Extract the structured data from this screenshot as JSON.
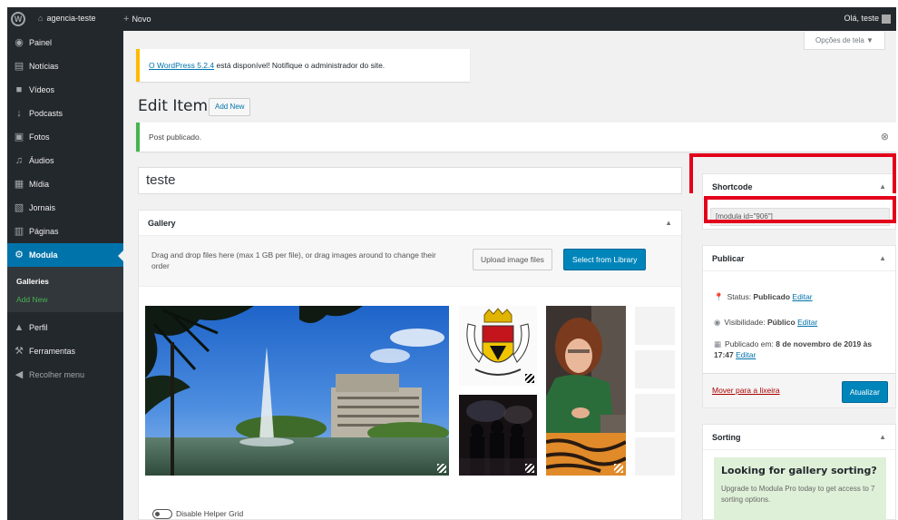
{
  "admin_bar": {
    "site_name": "agencia-teste",
    "new_label": "Novo",
    "howdy": "Olá, teste"
  },
  "sidebar": {
    "items": [
      {
        "label": "Painel",
        "icon": "dashboard-icon",
        "glyph": "◉"
      },
      {
        "label": "Notícias",
        "icon": "posts-icon",
        "glyph": "▤"
      },
      {
        "label": "Vídeos",
        "icon": "video-icon",
        "glyph": "■"
      },
      {
        "label": "Podcasts",
        "icon": "microphone-icon",
        "glyph": "↓"
      },
      {
        "label": "Fotos",
        "icon": "image-icon",
        "glyph": "▣"
      },
      {
        "label": "Áudios",
        "icon": "music-icon",
        "glyph": "♫"
      },
      {
        "label": "Mídia",
        "icon": "media-icon",
        "glyph": "▦"
      },
      {
        "label": "Jornais",
        "icon": "newspaper-icon",
        "glyph": "▧"
      },
      {
        "label": "Páginas",
        "icon": "pages-icon",
        "glyph": "▥"
      },
      {
        "label": "Modula",
        "icon": "gear-icon",
        "glyph": "⚙"
      }
    ],
    "submenu": [
      {
        "label": "Galleries"
      },
      {
        "label": "Add New"
      }
    ],
    "bottom_items": [
      {
        "label": "Perfil",
        "icon": "user-icon",
        "glyph": "▲"
      },
      {
        "label": "Ferramentas",
        "icon": "wrench-icon",
        "glyph": "⚒"
      },
      {
        "label": "Recolher menu",
        "icon": "collapse-icon",
        "glyph": "◀"
      }
    ]
  },
  "screen_options": "Opções de tela ▼",
  "update_notice": {
    "link": "O WordPress 5.2.4",
    "text": " está disponível! Notifique o administrador do site."
  },
  "page": {
    "title": "Edit Item",
    "add_new": "Add New"
  },
  "success_notice": "Post publicado.",
  "title_value": "teste",
  "gallery": {
    "heading": "Gallery",
    "hint": "Drag and drop files here (max 1 GB per file), or drag images around to change their order",
    "upload_button": "Upload image files",
    "library_button": "Select from Library",
    "helper_grid": "Disable Helper Grid"
  },
  "shortcode": {
    "heading": "Shortcode",
    "value": "[modula id=\"906\"]"
  },
  "publish": {
    "heading": "Publicar",
    "status_label": "Status: ",
    "status_value": "Publicado",
    "visibility_label": "Visibilidade: ",
    "visibility_value": "Público",
    "published_label": "Publicado em: ",
    "published_value": "8 de novembro de 2019 às 17:47",
    "edit_link": "Editar",
    "trash": "Mover para a lixeira",
    "update": "Atualizar"
  },
  "sorting": {
    "heading": "Sorting",
    "promo_title": "Looking for gallery sorting?",
    "promo_body": "Upgrade to Modula Pro today to get access to 7 sorting options."
  },
  "colors": {
    "accent": "#0073aa",
    "button": "#0085ba",
    "highlight": "#e3001b"
  }
}
